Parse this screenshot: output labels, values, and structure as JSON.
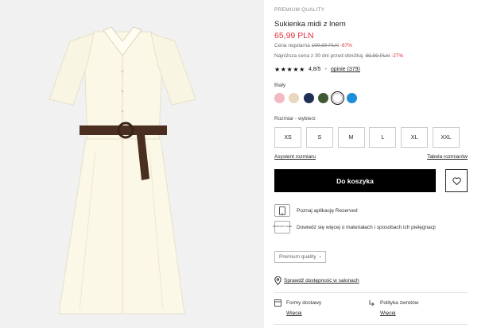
{
  "product": {
    "tag": "PREMIUM QUALITY",
    "title": "Sukienka midi z lnem",
    "price": "65,99 PLN",
    "regular_label": "Cena regularna",
    "regular_price": "199,99 PLN",
    "regular_discount": "-67%",
    "lowest_label": "Najniższa cena z 30 dni przed obniżką:",
    "lowest_price": "89,99 PLN",
    "lowest_discount": "-27%",
    "stars": "★★★★★",
    "rating": "4,8/5",
    "rating_sep": "•",
    "reviews": "opinie (379)"
  },
  "colors": {
    "label": "Biały",
    "swatches": [
      "#f3b9c2",
      "#e9d6be",
      "#1f2f55",
      "#3f5a35",
      "#ffffff",
      "#1f8ed8"
    ],
    "selected_index": 4
  },
  "sizes": {
    "label": "Rozmiar -  wybierz",
    "options": [
      "XS",
      "S",
      "M",
      "L",
      "XL",
      "XXL"
    ]
  },
  "links": {
    "assistant": "Asystent rozmiaru",
    "table": "Tabela rozmiarów"
  },
  "cart": {
    "label": "Do koszyka"
  },
  "info": {
    "app": "Poznaj aplikację Reserved",
    "care_icon_text": "PRODUCT CARE",
    "care": "Dowiedz się więcej o materiałach i sposobach ich pielęgnacji"
  },
  "premium": {
    "label": "Premium quality"
  },
  "store": {
    "label": "Sprawdź dostępność w salonach"
  },
  "shipping": {
    "delivery_label": "Formy dostawy",
    "delivery_more": "Więcej",
    "returns_label": "Polityka zwrotów",
    "returns_more": "Więcej"
  },
  "colors_theme": {
    "accent": "#e0303a",
    "button": "#000000"
  }
}
